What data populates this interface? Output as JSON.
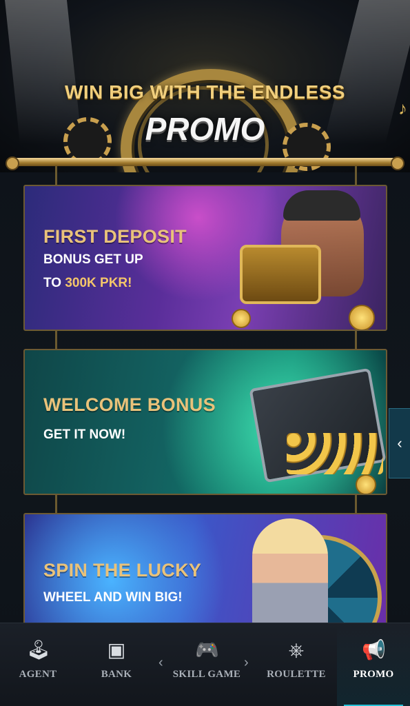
{
  "header": {
    "title": "WIN BIG WITH THE ENDLESS",
    "subtitle": "PROMO"
  },
  "banners": [
    {
      "title": "FIRST DEPOSIT",
      "line1": "BONUS GET UP",
      "line2_prefix": "TO ",
      "line2_highlight": "300K PKR!"
    },
    {
      "title": "WELCOME BONUS",
      "line1": "GET IT NOW!"
    },
    {
      "title": "SPIN THE LUCKY",
      "line1": "WHEEL AND WIN BIG!"
    }
  ],
  "side_tab": {
    "icon": "chevron-left-icon",
    "glyph": "‹"
  },
  "nav": {
    "items": [
      {
        "label": "AGENT",
        "icon": "agent-icon",
        "glyph": "🕹"
      },
      {
        "label": "BANK",
        "icon": "safe-icon",
        "glyph": "▣"
      },
      {
        "label": "SKILL GAME",
        "icon": "gamepad-icon",
        "glyph": "🎮"
      },
      {
        "label": "ROULETTE",
        "icon": "roulette-icon",
        "glyph": "⎈"
      },
      {
        "label": "PROMO",
        "icon": "megaphone-icon",
        "glyph": "📢"
      }
    ],
    "active": "PROMO",
    "prev_glyph": "‹",
    "next_glyph": "›"
  },
  "colors": {
    "gold": "#e9c27a",
    "accent": "#24c0d6"
  }
}
